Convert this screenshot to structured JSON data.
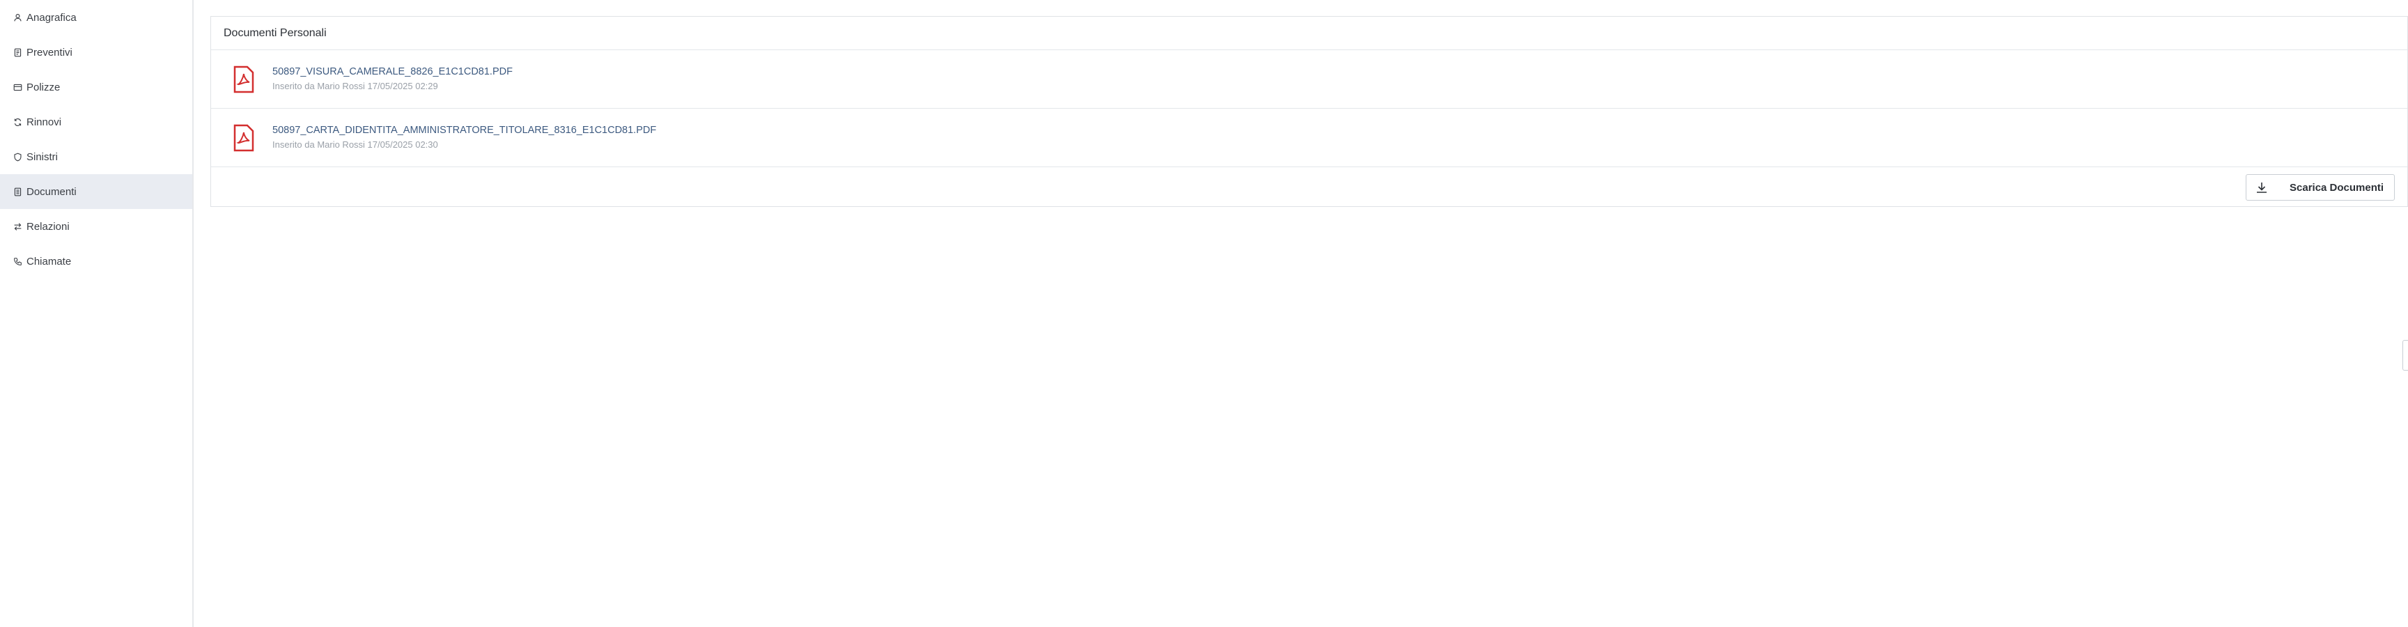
{
  "sidebar": {
    "items": [
      {
        "label": "Anagrafica",
        "icon": "user-icon",
        "active": false
      },
      {
        "label": "Preventivi",
        "icon": "receipt-icon",
        "active": false
      },
      {
        "label": "Polizze",
        "icon": "card-icon",
        "active": false
      },
      {
        "label": "Rinnovi",
        "icon": "refresh-icon",
        "active": false
      },
      {
        "label": "Sinistri",
        "icon": "shield-icon",
        "active": false
      },
      {
        "label": "Documenti",
        "icon": "document-icon",
        "active": true
      },
      {
        "label": "Relazioni",
        "icon": "swap-icon",
        "active": false
      },
      {
        "label": "Chiamate",
        "icon": "phone-icon",
        "active": false
      }
    ]
  },
  "documents_panel": {
    "title": "Documenti Personali",
    "files": [
      {
        "name": "50897_VISURA_CAMERALE_8826_E1C1CD81.PDF",
        "meta": "Inserito da Mario Rossi 17/05/2025 02:29",
        "icon": "pdf-icon"
      },
      {
        "name": "50897_CARTA_DIDENTITA_AMMINISTRATORE_TITOLARE_8316_E1C1CD81.PDF",
        "meta": "Inserito da Mario Rossi 17/05/2025 02:30",
        "icon": "pdf-icon"
      }
    ],
    "download_button": {
      "label": "Scarica Documenti",
      "icon": "download-icon"
    }
  },
  "colors": {
    "pdf_red": "#d32f2f",
    "link_blue": "#3d5a80",
    "active_bg": "#e9ecf2"
  }
}
